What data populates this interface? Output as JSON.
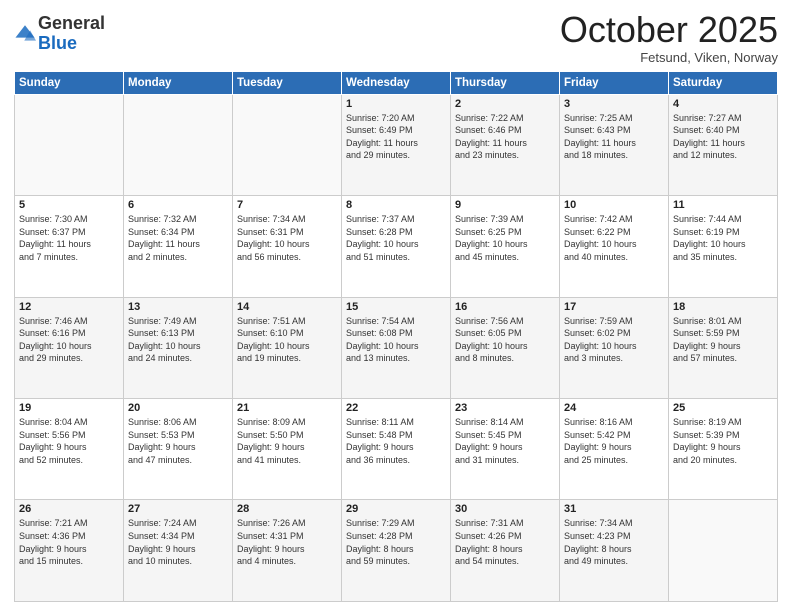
{
  "header": {
    "logo_line1": "General",
    "logo_line2": "Blue",
    "month": "October 2025",
    "location": "Fetsund, Viken, Norway"
  },
  "days_of_week": [
    "Sunday",
    "Monday",
    "Tuesday",
    "Wednesday",
    "Thursday",
    "Friday",
    "Saturday"
  ],
  "weeks": [
    [
      {
        "day": "",
        "info": ""
      },
      {
        "day": "",
        "info": ""
      },
      {
        "day": "",
        "info": ""
      },
      {
        "day": "1",
        "info": "Sunrise: 7:20 AM\nSunset: 6:49 PM\nDaylight: 11 hours\nand 29 minutes."
      },
      {
        "day": "2",
        "info": "Sunrise: 7:22 AM\nSunset: 6:46 PM\nDaylight: 11 hours\nand 23 minutes."
      },
      {
        "day": "3",
        "info": "Sunrise: 7:25 AM\nSunset: 6:43 PM\nDaylight: 11 hours\nand 18 minutes."
      },
      {
        "day": "4",
        "info": "Sunrise: 7:27 AM\nSunset: 6:40 PM\nDaylight: 11 hours\nand 12 minutes."
      }
    ],
    [
      {
        "day": "5",
        "info": "Sunrise: 7:30 AM\nSunset: 6:37 PM\nDaylight: 11 hours\nand 7 minutes."
      },
      {
        "day": "6",
        "info": "Sunrise: 7:32 AM\nSunset: 6:34 PM\nDaylight: 11 hours\nand 2 minutes."
      },
      {
        "day": "7",
        "info": "Sunrise: 7:34 AM\nSunset: 6:31 PM\nDaylight: 10 hours\nand 56 minutes."
      },
      {
        "day": "8",
        "info": "Sunrise: 7:37 AM\nSunset: 6:28 PM\nDaylight: 10 hours\nand 51 minutes."
      },
      {
        "day": "9",
        "info": "Sunrise: 7:39 AM\nSunset: 6:25 PM\nDaylight: 10 hours\nand 45 minutes."
      },
      {
        "day": "10",
        "info": "Sunrise: 7:42 AM\nSunset: 6:22 PM\nDaylight: 10 hours\nand 40 minutes."
      },
      {
        "day": "11",
        "info": "Sunrise: 7:44 AM\nSunset: 6:19 PM\nDaylight: 10 hours\nand 35 minutes."
      }
    ],
    [
      {
        "day": "12",
        "info": "Sunrise: 7:46 AM\nSunset: 6:16 PM\nDaylight: 10 hours\nand 29 minutes."
      },
      {
        "day": "13",
        "info": "Sunrise: 7:49 AM\nSunset: 6:13 PM\nDaylight: 10 hours\nand 24 minutes."
      },
      {
        "day": "14",
        "info": "Sunrise: 7:51 AM\nSunset: 6:10 PM\nDaylight: 10 hours\nand 19 minutes."
      },
      {
        "day": "15",
        "info": "Sunrise: 7:54 AM\nSunset: 6:08 PM\nDaylight: 10 hours\nand 13 minutes."
      },
      {
        "day": "16",
        "info": "Sunrise: 7:56 AM\nSunset: 6:05 PM\nDaylight: 10 hours\nand 8 minutes."
      },
      {
        "day": "17",
        "info": "Sunrise: 7:59 AM\nSunset: 6:02 PM\nDaylight: 10 hours\nand 3 minutes."
      },
      {
        "day": "18",
        "info": "Sunrise: 8:01 AM\nSunset: 5:59 PM\nDaylight: 9 hours\nand 57 minutes."
      }
    ],
    [
      {
        "day": "19",
        "info": "Sunrise: 8:04 AM\nSunset: 5:56 PM\nDaylight: 9 hours\nand 52 minutes."
      },
      {
        "day": "20",
        "info": "Sunrise: 8:06 AM\nSunset: 5:53 PM\nDaylight: 9 hours\nand 47 minutes."
      },
      {
        "day": "21",
        "info": "Sunrise: 8:09 AM\nSunset: 5:50 PM\nDaylight: 9 hours\nand 41 minutes."
      },
      {
        "day": "22",
        "info": "Sunrise: 8:11 AM\nSunset: 5:48 PM\nDaylight: 9 hours\nand 36 minutes."
      },
      {
        "day": "23",
        "info": "Sunrise: 8:14 AM\nSunset: 5:45 PM\nDaylight: 9 hours\nand 31 minutes."
      },
      {
        "day": "24",
        "info": "Sunrise: 8:16 AM\nSunset: 5:42 PM\nDaylight: 9 hours\nand 25 minutes."
      },
      {
        "day": "25",
        "info": "Sunrise: 8:19 AM\nSunset: 5:39 PM\nDaylight: 9 hours\nand 20 minutes."
      }
    ],
    [
      {
        "day": "26",
        "info": "Sunrise: 7:21 AM\nSunset: 4:36 PM\nDaylight: 9 hours\nand 15 minutes."
      },
      {
        "day": "27",
        "info": "Sunrise: 7:24 AM\nSunset: 4:34 PM\nDaylight: 9 hours\nand 10 minutes."
      },
      {
        "day": "28",
        "info": "Sunrise: 7:26 AM\nSunset: 4:31 PM\nDaylight: 9 hours\nand 4 minutes."
      },
      {
        "day": "29",
        "info": "Sunrise: 7:29 AM\nSunset: 4:28 PM\nDaylight: 8 hours\nand 59 minutes."
      },
      {
        "day": "30",
        "info": "Sunrise: 7:31 AM\nSunset: 4:26 PM\nDaylight: 8 hours\nand 54 minutes."
      },
      {
        "day": "31",
        "info": "Sunrise: 7:34 AM\nSunset: 4:23 PM\nDaylight: 8 hours\nand 49 minutes."
      },
      {
        "day": "",
        "info": ""
      }
    ]
  ]
}
